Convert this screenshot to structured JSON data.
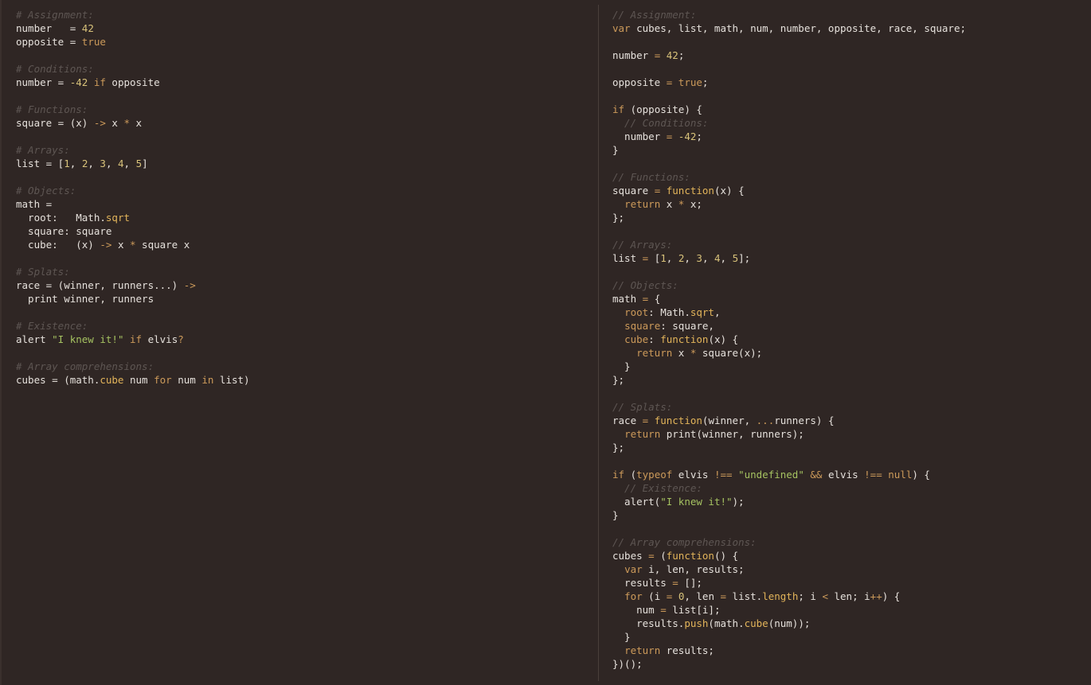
{
  "theme": {
    "background": "#2f2624",
    "text": "#e6e1dc",
    "comment": "#5e5653",
    "keyword": "#cc9a5a",
    "number": "#d8c27a",
    "string": "#a5c261",
    "function": "#e2b45a"
  },
  "coffee_pane": {
    "lines": [
      [
        [
          "# Assignment:",
          "comment"
        ]
      ],
      [
        [
          "number   = ",
          "text"
        ],
        [
          "42",
          "num"
        ]
      ],
      [
        [
          "opposite = ",
          "text"
        ],
        [
          "true",
          "kw"
        ]
      ],
      [],
      [
        [
          "# Conditions:",
          "comment"
        ]
      ],
      [
        [
          "number = ",
          "text"
        ],
        [
          "-42",
          "num"
        ],
        [
          " ",
          "text"
        ],
        [
          "if",
          "kw"
        ],
        [
          " opposite",
          "text"
        ]
      ],
      [],
      [
        [
          "# Functions:",
          "comment"
        ]
      ],
      [
        [
          "square = (x) ",
          "text"
        ],
        [
          "->",
          "op"
        ],
        [
          " x ",
          "text"
        ],
        [
          "*",
          "op"
        ],
        [
          " x",
          "text"
        ]
      ],
      [],
      [
        [
          "# Arrays:",
          "comment"
        ]
      ],
      [
        [
          "list = [",
          "text"
        ],
        [
          "1",
          "num"
        ],
        [
          ", ",
          "text"
        ],
        [
          "2",
          "num"
        ],
        [
          ", ",
          "text"
        ],
        [
          "3",
          "num"
        ],
        [
          ", ",
          "text"
        ],
        [
          "4",
          "num"
        ],
        [
          ", ",
          "text"
        ],
        [
          "5",
          "num"
        ],
        [
          "]",
          "text"
        ]
      ],
      [],
      [
        [
          "# Objects:",
          "comment"
        ]
      ],
      [
        [
          "math =",
          "text"
        ]
      ],
      [
        [
          "  root:   Math.",
          "text"
        ],
        [
          "sqrt",
          "fn"
        ]
      ],
      [
        [
          "  square: square",
          "text"
        ]
      ],
      [
        [
          "  cube:   (x) ",
          "text"
        ],
        [
          "->",
          "op"
        ],
        [
          " x ",
          "text"
        ],
        [
          "*",
          "op"
        ],
        [
          " square x",
          "text"
        ]
      ],
      [],
      [
        [
          "# Splats:",
          "comment"
        ]
      ],
      [
        [
          "race = (winner, runners...) ",
          "text"
        ],
        [
          "->",
          "op"
        ]
      ],
      [
        [
          "  print winner, runners",
          "text"
        ]
      ],
      [],
      [
        [
          "# Existence:",
          "comment"
        ]
      ],
      [
        [
          "alert ",
          "text"
        ],
        [
          "\"I knew it!\"",
          "str"
        ],
        [
          " ",
          "text"
        ],
        [
          "if",
          "kw"
        ],
        [
          " elvis",
          "text"
        ],
        [
          "?",
          "op"
        ]
      ],
      [],
      [
        [
          "# Array comprehensions:",
          "comment"
        ]
      ],
      [
        [
          "cubes = (math.",
          "text"
        ],
        [
          "cube",
          "fn"
        ],
        [
          " num ",
          "text"
        ],
        [
          "for",
          "kw"
        ],
        [
          " num ",
          "text"
        ],
        [
          "in",
          "kw"
        ],
        [
          " list)",
          "text"
        ]
      ]
    ]
  },
  "js_pane": {
    "lines": [
      [
        [
          "// Assignment:",
          "comment"
        ]
      ],
      [
        [
          "var",
          "kw"
        ],
        [
          " cubes, list, math, num, number, opposite, race, square;",
          "text"
        ]
      ],
      [],
      [
        [
          "number ",
          "text"
        ],
        [
          "=",
          "op"
        ],
        [
          " ",
          "text"
        ],
        [
          "42",
          "num"
        ],
        [
          ";",
          "text"
        ]
      ],
      [],
      [
        [
          "opposite ",
          "text"
        ],
        [
          "=",
          "op"
        ],
        [
          " ",
          "text"
        ],
        [
          "true",
          "kw"
        ],
        [
          ";",
          "text"
        ]
      ],
      [],
      [
        [
          "if",
          "kw"
        ],
        [
          " (opposite) {",
          "text"
        ]
      ],
      [
        [
          "  // Conditions:",
          "comment"
        ]
      ],
      [
        [
          "  number ",
          "text"
        ],
        [
          "=",
          "op"
        ],
        [
          " ",
          "text"
        ],
        [
          "-42",
          "num"
        ],
        [
          ";",
          "text"
        ]
      ],
      [
        [
          "}",
          "text"
        ]
      ],
      [],
      [
        [
          "// Functions:",
          "comment"
        ]
      ],
      [
        [
          "square ",
          "text"
        ],
        [
          "=",
          "op"
        ],
        [
          " ",
          "text"
        ],
        [
          "function",
          "fn"
        ],
        [
          "(x) {",
          "text"
        ]
      ],
      [
        [
          "  ",
          "text"
        ],
        [
          "return",
          "kw"
        ],
        [
          " x ",
          "text"
        ],
        [
          "*",
          "op"
        ],
        [
          " x;",
          "text"
        ]
      ],
      [
        [
          "};",
          "text"
        ]
      ],
      [],
      [
        [
          "// Arrays:",
          "comment"
        ]
      ],
      [
        [
          "list ",
          "text"
        ],
        [
          "=",
          "op"
        ],
        [
          " [",
          "text"
        ],
        [
          "1",
          "num"
        ],
        [
          ", ",
          "text"
        ],
        [
          "2",
          "num"
        ],
        [
          ", ",
          "text"
        ],
        [
          "3",
          "num"
        ],
        [
          ", ",
          "text"
        ],
        [
          "4",
          "num"
        ],
        [
          ", ",
          "text"
        ],
        [
          "5",
          "num"
        ],
        [
          "];",
          "text"
        ]
      ],
      [],
      [
        [
          "// Objects:",
          "comment"
        ]
      ],
      [
        [
          "math ",
          "text"
        ],
        [
          "=",
          "op"
        ],
        [
          " {",
          "text"
        ]
      ],
      [
        [
          "  ",
          "text"
        ],
        [
          "root",
          "kw"
        ],
        [
          ": Math.",
          "text"
        ],
        [
          "sqrt",
          "fn"
        ],
        [
          ",",
          "text"
        ]
      ],
      [
        [
          "  ",
          "text"
        ],
        [
          "square",
          "kw"
        ],
        [
          ": square,",
          "text"
        ]
      ],
      [
        [
          "  ",
          "text"
        ],
        [
          "cube",
          "kw"
        ],
        [
          ": ",
          "text"
        ],
        [
          "function",
          "fn"
        ],
        [
          "(x) {",
          "text"
        ]
      ],
      [
        [
          "    ",
          "text"
        ],
        [
          "return",
          "kw"
        ],
        [
          " x ",
          "text"
        ],
        [
          "*",
          "op"
        ],
        [
          " square(x);",
          "text"
        ]
      ],
      [
        [
          "  }",
          "text"
        ]
      ],
      [
        [
          "};",
          "text"
        ]
      ],
      [],
      [
        [
          "// Splats:",
          "comment"
        ]
      ],
      [
        [
          "race ",
          "text"
        ],
        [
          "=",
          "op"
        ],
        [
          " ",
          "text"
        ],
        [
          "function",
          "fn"
        ],
        [
          "(winner, ",
          "text"
        ],
        [
          "...",
          "op"
        ],
        [
          "runners) {",
          "text"
        ]
      ],
      [
        [
          "  ",
          "text"
        ],
        [
          "return",
          "kw"
        ],
        [
          " print(winner, runners);",
          "text"
        ]
      ],
      [
        [
          "};",
          "text"
        ]
      ],
      [],
      [
        [
          "if",
          "kw"
        ],
        [
          " (",
          "text"
        ],
        [
          "typeof",
          "kw"
        ],
        [
          " elvis ",
          "text"
        ],
        [
          "!==",
          "op"
        ],
        [
          " ",
          "text"
        ],
        [
          "\"undefined\"",
          "str"
        ],
        [
          " ",
          "text"
        ],
        [
          "&&",
          "op"
        ],
        [
          " elvis ",
          "text"
        ],
        [
          "!==",
          "op"
        ],
        [
          " ",
          "text"
        ],
        [
          "null",
          "kw"
        ],
        [
          ") {",
          "text"
        ]
      ],
      [
        [
          "  // Existence:",
          "comment"
        ]
      ],
      [
        [
          "  alert(",
          "text"
        ],
        [
          "\"I knew it!\"",
          "str"
        ],
        [
          ");",
          "text"
        ]
      ],
      [
        [
          "}",
          "text"
        ]
      ],
      [],
      [
        [
          "// Array comprehensions:",
          "comment"
        ]
      ],
      [
        [
          "cubes ",
          "text"
        ],
        [
          "=",
          "op"
        ],
        [
          " (",
          "text"
        ],
        [
          "function",
          "fn"
        ],
        [
          "() {",
          "text"
        ]
      ],
      [
        [
          "  ",
          "text"
        ],
        [
          "var",
          "kw"
        ],
        [
          " i, len, results;",
          "text"
        ]
      ],
      [
        [
          "  results ",
          "text"
        ],
        [
          "=",
          "op"
        ],
        [
          " [];",
          "text"
        ]
      ],
      [
        [
          "  ",
          "text"
        ],
        [
          "for",
          "kw"
        ],
        [
          " (i ",
          "text"
        ],
        [
          "=",
          "op"
        ],
        [
          " ",
          "text"
        ],
        [
          "0",
          "num"
        ],
        [
          ", len ",
          "text"
        ],
        [
          "=",
          "op"
        ],
        [
          " list.",
          "text"
        ],
        [
          "length",
          "fn"
        ],
        [
          "; i ",
          "text"
        ],
        [
          "<",
          "op"
        ],
        [
          " len; i",
          "text"
        ],
        [
          "++",
          "op"
        ],
        [
          ") {",
          "text"
        ]
      ],
      [
        [
          "    num ",
          "text"
        ],
        [
          "=",
          "op"
        ],
        [
          " list[i];",
          "text"
        ]
      ],
      [
        [
          "    results.",
          "text"
        ],
        [
          "push",
          "fn"
        ],
        [
          "(math.",
          "text"
        ],
        [
          "cube",
          "fn"
        ],
        [
          "(num));",
          "text"
        ]
      ],
      [
        [
          "  }",
          "text"
        ]
      ],
      [
        [
          "  ",
          "text"
        ],
        [
          "return",
          "kw"
        ],
        [
          " results;",
          "text"
        ]
      ],
      [
        [
          "})();",
          "text"
        ]
      ]
    ]
  }
}
